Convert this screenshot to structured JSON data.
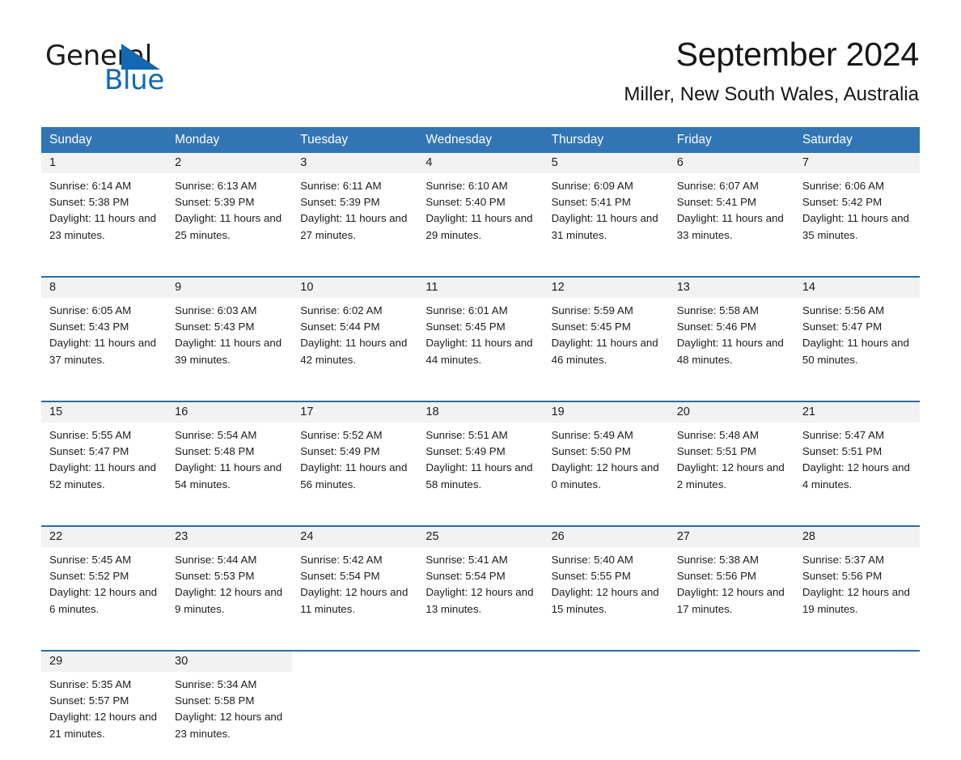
{
  "brand": {
    "name_part1": "General",
    "name_part2": "Blue",
    "logo_icon": "triangle-logo-icon",
    "accent_color": "#1268b3"
  },
  "header": {
    "month_title": "September 2024",
    "location": "Miller, New South Wales, Australia"
  },
  "theme": {
    "header_blue": "#3175b5",
    "rule_blue": "#2e6da4",
    "daynum_band": "#f2f2f2",
    "text": "#1c1c1c"
  },
  "calendar": {
    "weekday_headers": [
      "Sunday",
      "Monday",
      "Tuesday",
      "Wednesday",
      "Thursday",
      "Friday",
      "Saturday"
    ],
    "weeks": [
      [
        {
          "day": "1",
          "sunrise": "Sunrise: 6:14 AM",
          "sunset": "Sunset: 5:38 PM",
          "daylight": "Daylight: 11 hours and 23 minutes."
        },
        {
          "day": "2",
          "sunrise": "Sunrise: 6:13 AM",
          "sunset": "Sunset: 5:39 PM",
          "daylight": "Daylight: 11 hours and 25 minutes."
        },
        {
          "day": "3",
          "sunrise": "Sunrise: 6:11 AM",
          "sunset": "Sunset: 5:39 PM",
          "daylight": "Daylight: 11 hours and 27 minutes."
        },
        {
          "day": "4",
          "sunrise": "Sunrise: 6:10 AM",
          "sunset": "Sunset: 5:40 PM",
          "daylight": "Daylight: 11 hours and 29 minutes."
        },
        {
          "day": "5",
          "sunrise": "Sunrise: 6:09 AM",
          "sunset": "Sunset: 5:41 PM",
          "daylight": "Daylight: 11 hours and 31 minutes."
        },
        {
          "day": "6",
          "sunrise": "Sunrise: 6:07 AM",
          "sunset": "Sunset: 5:41 PM",
          "daylight": "Daylight: 11 hours and 33 minutes."
        },
        {
          "day": "7",
          "sunrise": "Sunrise: 6:06 AM",
          "sunset": "Sunset: 5:42 PM",
          "daylight": "Daylight: 11 hours and 35 minutes."
        }
      ],
      [
        {
          "day": "8",
          "sunrise": "Sunrise: 6:05 AM",
          "sunset": "Sunset: 5:43 PM",
          "daylight": "Daylight: 11 hours and 37 minutes."
        },
        {
          "day": "9",
          "sunrise": "Sunrise: 6:03 AM",
          "sunset": "Sunset: 5:43 PM",
          "daylight": "Daylight: 11 hours and 39 minutes."
        },
        {
          "day": "10",
          "sunrise": "Sunrise: 6:02 AM",
          "sunset": "Sunset: 5:44 PM",
          "daylight": "Daylight: 11 hours and 42 minutes."
        },
        {
          "day": "11",
          "sunrise": "Sunrise: 6:01 AM",
          "sunset": "Sunset: 5:45 PM",
          "daylight": "Daylight: 11 hours and 44 minutes."
        },
        {
          "day": "12",
          "sunrise": "Sunrise: 5:59 AM",
          "sunset": "Sunset: 5:45 PM",
          "daylight": "Daylight: 11 hours and 46 minutes."
        },
        {
          "day": "13",
          "sunrise": "Sunrise: 5:58 AM",
          "sunset": "Sunset: 5:46 PM",
          "daylight": "Daylight: 11 hours and 48 minutes."
        },
        {
          "day": "14",
          "sunrise": "Sunrise: 5:56 AM",
          "sunset": "Sunset: 5:47 PM",
          "daylight": "Daylight: 11 hours and 50 minutes."
        }
      ],
      [
        {
          "day": "15",
          "sunrise": "Sunrise: 5:55 AM",
          "sunset": "Sunset: 5:47 PM",
          "daylight": "Daylight: 11 hours and 52 minutes."
        },
        {
          "day": "16",
          "sunrise": "Sunrise: 5:54 AM",
          "sunset": "Sunset: 5:48 PM",
          "daylight": "Daylight: 11 hours and 54 minutes."
        },
        {
          "day": "17",
          "sunrise": "Sunrise: 5:52 AM",
          "sunset": "Sunset: 5:49 PM",
          "daylight": "Daylight: 11 hours and 56 minutes."
        },
        {
          "day": "18",
          "sunrise": "Sunrise: 5:51 AM",
          "sunset": "Sunset: 5:49 PM",
          "daylight": "Daylight: 11 hours and 58 minutes."
        },
        {
          "day": "19",
          "sunrise": "Sunrise: 5:49 AM",
          "sunset": "Sunset: 5:50 PM",
          "daylight": "Daylight: 12 hours and 0 minutes."
        },
        {
          "day": "20",
          "sunrise": "Sunrise: 5:48 AM",
          "sunset": "Sunset: 5:51 PM",
          "daylight": "Daylight: 12 hours and 2 minutes."
        },
        {
          "day": "21",
          "sunrise": "Sunrise: 5:47 AM",
          "sunset": "Sunset: 5:51 PM",
          "daylight": "Daylight: 12 hours and 4 minutes."
        }
      ],
      [
        {
          "day": "22",
          "sunrise": "Sunrise: 5:45 AM",
          "sunset": "Sunset: 5:52 PM",
          "daylight": "Daylight: 12 hours and 6 minutes."
        },
        {
          "day": "23",
          "sunrise": "Sunrise: 5:44 AM",
          "sunset": "Sunset: 5:53 PM",
          "daylight": "Daylight: 12 hours and 9 minutes."
        },
        {
          "day": "24",
          "sunrise": "Sunrise: 5:42 AM",
          "sunset": "Sunset: 5:54 PM",
          "daylight": "Daylight: 12 hours and 11 minutes."
        },
        {
          "day": "25",
          "sunrise": "Sunrise: 5:41 AM",
          "sunset": "Sunset: 5:54 PM",
          "daylight": "Daylight: 12 hours and 13 minutes."
        },
        {
          "day": "26",
          "sunrise": "Sunrise: 5:40 AM",
          "sunset": "Sunset: 5:55 PM",
          "daylight": "Daylight: 12 hours and 15 minutes."
        },
        {
          "day": "27",
          "sunrise": "Sunrise: 5:38 AM",
          "sunset": "Sunset: 5:56 PM",
          "daylight": "Daylight: 12 hours and 17 minutes."
        },
        {
          "day": "28",
          "sunrise": "Sunrise: 5:37 AM",
          "sunset": "Sunset: 5:56 PM",
          "daylight": "Daylight: 12 hours and 19 minutes."
        }
      ],
      [
        {
          "day": "29",
          "sunrise": "Sunrise: 5:35 AM",
          "sunset": "Sunset: 5:57 PM",
          "daylight": "Daylight: 12 hours and 21 minutes."
        },
        {
          "day": "30",
          "sunrise": "Sunrise: 5:34 AM",
          "sunset": "Sunset: 5:58 PM",
          "daylight": "Daylight: 12 hours and 23 minutes."
        },
        {
          "day": "",
          "sunrise": "",
          "sunset": "",
          "daylight": ""
        },
        {
          "day": "",
          "sunrise": "",
          "sunset": "",
          "daylight": ""
        },
        {
          "day": "",
          "sunrise": "",
          "sunset": "",
          "daylight": ""
        },
        {
          "day": "",
          "sunrise": "",
          "sunset": "",
          "daylight": ""
        },
        {
          "day": "",
          "sunrise": "",
          "sunset": "",
          "daylight": ""
        }
      ]
    ]
  }
}
